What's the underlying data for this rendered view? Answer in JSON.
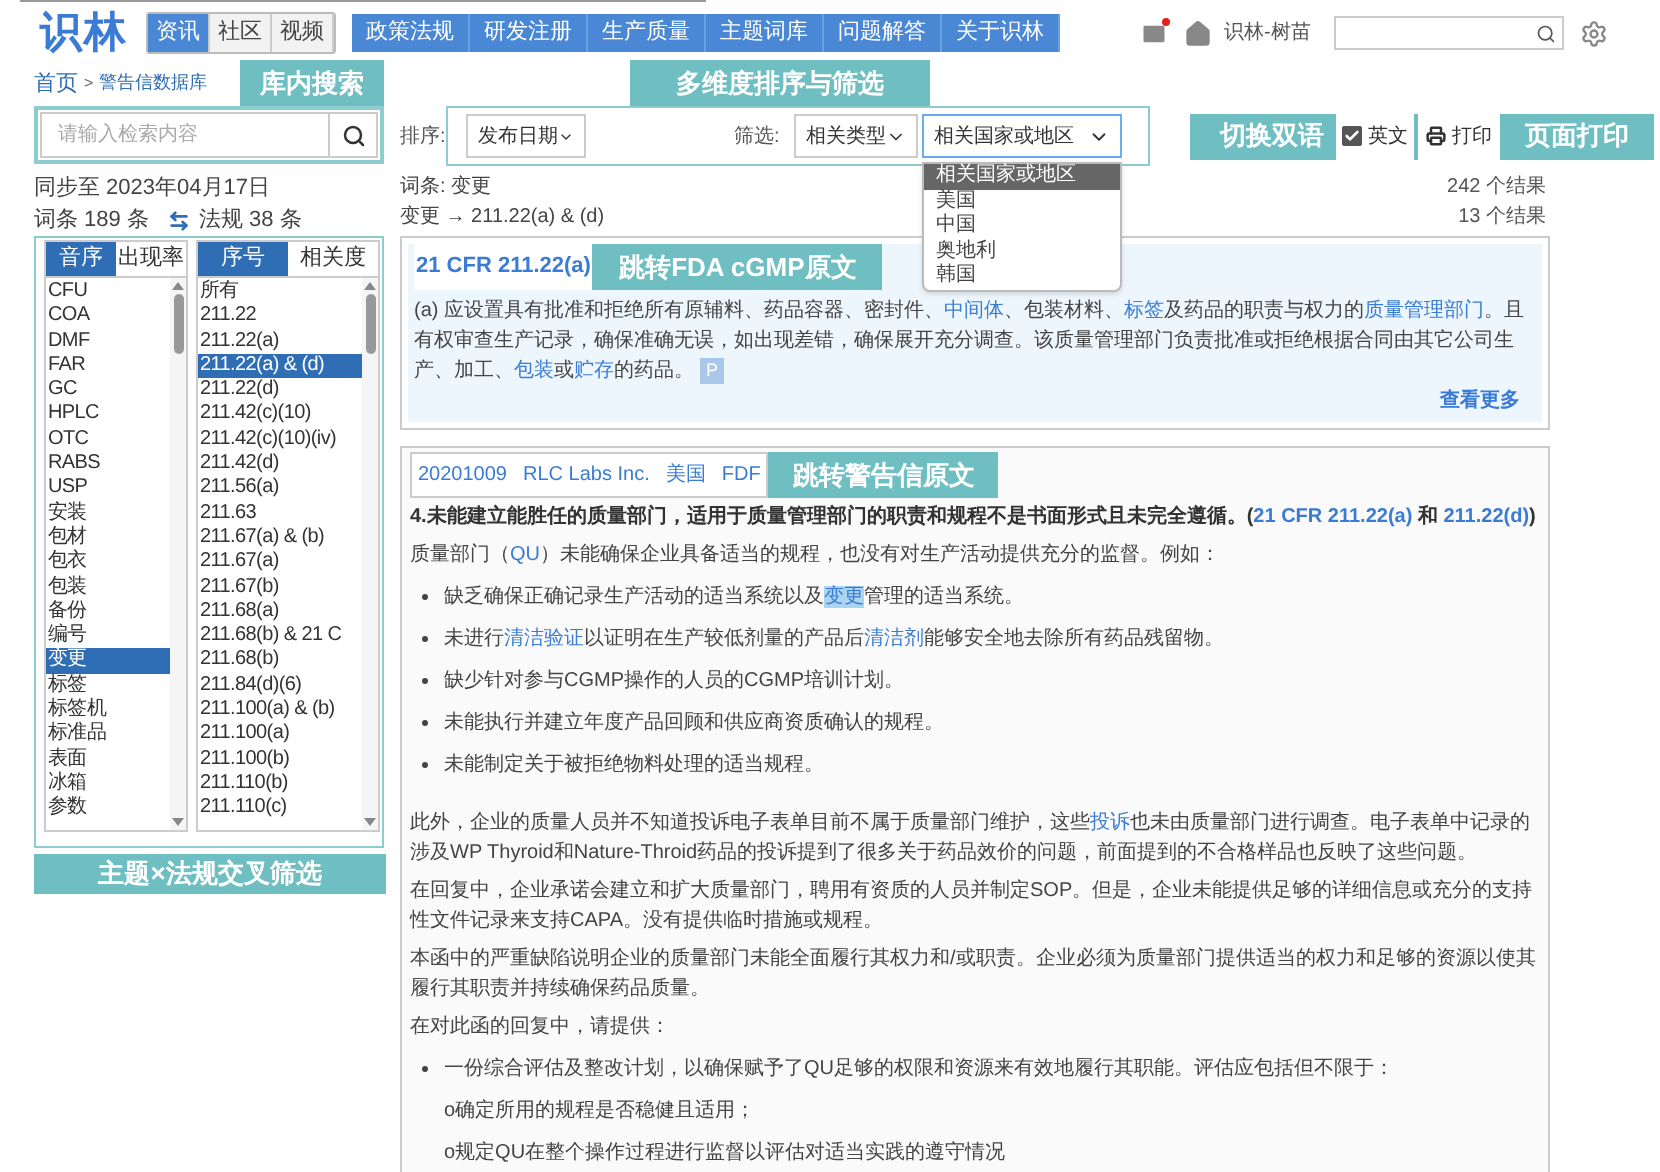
{
  "header": {
    "logo": "识林",
    "tabs": [
      {
        "label": "资讯",
        "selected": true
      },
      {
        "label": "社区",
        "selected": false
      },
      {
        "label": "视频",
        "selected": false
      }
    ],
    "nav": [
      "政策法规",
      "研发注册",
      "生产质量",
      "主题词库",
      "问题解答",
      "关于识林"
    ],
    "mail_unread": true,
    "user": "识林-树苗"
  },
  "breadcrumb": {
    "home": "首页",
    "separator": ">",
    "current": "警告信数据库"
  },
  "search": {
    "placeholder": "请输入检索内容"
  },
  "sync": "同步至 2023年04月17日",
  "counts": {
    "terms": "词条 189 条",
    "regs": "法规 38 条"
  },
  "topic_list": {
    "tabs": [
      {
        "label": "音序",
        "selected": true
      },
      {
        "label": "出现率",
        "selected": false
      }
    ],
    "items": [
      {
        "label": "CFU",
        "selected": false
      },
      {
        "label": "COA",
        "selected": false
      },
      {
        "label": "DMF",
        "selected": false
      },
      {
        "label": "FAR",
        "selected": false
      },
      {
        "label": "GC",
        "selected": false
      },
      {
        "label": "HPLC",
        "selected": false
      },
      {
        "label": "OTC",
        "selected": false
      },
      {
        "label": "RABS",
        "selected": false
      },
      {
        "label": "USP",
        "selected": false
      },
      {
        "label": "安装",
        "selected": false
      },
      {
        "label": "包材",
        "selected": false
      },
      {
        "label": "包衣",
        "selected": false
      },
      {
        "label": "包装",
        "selected": false
      },
      {
        "label": "备份",
        "selected": false
      },
      {
        "label": "编号",
        "selected": false
      },
      {
        "label": "变更",
        "selected": true
      },
      {
        "label": "标签",
        "selected": false
      },
      {
        "label": "标签机",
        "selected": false
      },
      {
        "label": "标准品",
        "selected": false
      },
      {
        "label": "表面",
        "selected": false
      },
      {
        "label": "冰箱",
        "selected": false
      },
      {
        "label": "参数",
        "selected": false
      }
    ]
  },
  "reg_list": {
    "tabs": [
      {
        "label": "序号",
        "selected": true
      },
      {
        "label": "相关度",
        "selected": false
      }
    ],
    "items": [
      {
        "label": "所有",
        "selected": false
      },
      {
        "label": "211.22",
        "selected": false
      },
      {
        "label": "211.22(a)",
        "selected": false
      },
      {
        "label": "211.22(a) & (d)",
        "selected": true
      },
      {
        "label": "211.22(d)",
        "selected": false
      },
      {
        "label": "211.42(c)(10)",
        "selected": false
      },
      {
        "label": "211.42(c)(10)(iv)",
        "selected": false
      },
      {
        "label": "211.42(d)",
        "selected": false
      },
      {
        "label": "211.56(a)",
        "selected": false
      },
      {
        "label": "211.63",
        "selected": false
      },
      {
        "label": "211.67(a) & (b)",
        "selected": false
      },
      {
        "label": "211.67(a)",
        "selected": false
      },
      {
        "label": "211.67(b)",
        "selected": false
      },
      {
        "label": "211.68(a)",
        "selected": false
      },
      {
        "label": "211.68(b) & 21 C",
        "selected": false
      },
      {
        "label": "211.68(b)",
        "selected": false
      },
      {
        "label": "211.84(d)(6)",
        "selected": false
      },
      {
        "label": "211.100(a) & (b)",
        "selected": false
      },
      {
        "label": "211.100(a)",
        "selected": false
      },
      {
        "label": "211.100(b)",
        "selected": false
      },
      {
        "label": "211.110(b)",
        "selected": false
      },
      {
        "label": "211.110(c)",
        "selected": false
      }
    ]
  },
  "toolbar": {
    "sort_label": "排序:",
    "sort_value": "发布日期",
    "filter_label": "筛选:",
    "type_value": "相关类型",
    "region_value": "相关国家或地区",
    "region_options": [
      {
        "label": "相关国家或地区",
        "selected": true
      },
      {
        "label": "美国",
        "selected": false
      },
      {
        "label": "中国",
        "selected": false
      },
      {
        "label": "奥地利",
        "selected": false
      },
      {
        "label": "韩国",
        "selected": false
      }
    ],
    "english": {
      "label": "英文",
      "checked": true
    },
    "print": "打印"
  },
  "summary": {
    "term": "词条: 变更",
    "path": "变更 → 211.22(a) & (d)",
    "total": "242 个结果",
    "sub": "13 个结果"
  },
  "reg_card": {
    "title": "21 CFR 211.22(a)",
    "body": [
      {
        "kind": "text",
        "text": "(a) 应设置具有批准和拒绝所有原辅料、药品容器、密封件、"
      },
      {
        "kind": "link",
        "text": "中间体"
      },
      {
        "kind": "text",
        "text": "、包装材料、"
      },
      {
        "kind": "link",
        "text": "标签"
      },
      {
        "kind": "text",
        "text": "及药品的职责与权力的"
      },
      {
        "kind": "link",
        "text": "质量管理部门"
      },
      {
        "kind": "text",
        "text": "。且有权审查生产记录，确保准确无误，如出现差错，确保展开充分调查。该质量管理部门负责批准或拒绝根据合同由其它公司生产、加工、"
      },
      {
        "kind": "link",
        "text": "包装"
      },
      {
        "kind": "text",
        "text": "或"
      },
      {
        "kind": "link",
        "text": "贮存"
      },
      {
        "kind": "text",
        "text": "的药品。"
      }
    ],
    "badge": "P",
    "more": "查看更多"
  },
  "letter_card": {
    "meta": [
      "20201009",
      "RLC Labs Inc.",
      "美国",
      "FDF"
    ],
    "blocks": [
      {
        "kind": "heading",
        "segs": [
          {
            "kind": "text",
            "text": "4.未能建立能胜任的质量部门，适用于质量管理部门的职责和规程不是书面形式且未完全遵循。("
          },
          {
            "kind": "link",
            "text": "21 CFR 211.22(a)"
          },
          {
            "kind": "text",
            "text": " 和 "
          },
          {
            "kind": "link",
            "text": "211.22(d)"
          },
          {
            "kind": "text",
            "text": ")"
          }
        ]
      },
      {
        "kind": "para",
        "segs": [
          {
            "kind": "text",
            "text": "质量部门（"
          },
          {
            "kind": "link",
            "text": "QU"
          },
          {
            "kind": "text",
            "text": "）未能确保企业具备适当的规程，也没有对生产活动提供充分的监督。例如："
          }
        ]
      },
      {
        "kind": "bullet",
        "segs": [
          {
            "kind": "text",
            "text": "缺乏确保正确记录生产活动的适当系统以及"
          },
          {
            "kind": "mark",
            "text": "变更"
          },
          {
            "kind": "text",
            "text": "管理的适当系统。"
          }
        ]
      },
      {
        "kind": "bullet",
        "segs": [
          {
            "kind": "text",
            "text": "未进行"
          },
          {
            "kind": "link",
            "text": "清洁验证"
          },
          {
            "kind": "text",
            "text": "以证明在生产较低剂量的产品后"
          },
          {
            "kind": "link",
            "text": "清洁剂"
          },
          {
            "kind": "text",
            "text": "能够安全地去除所有药品残留物。"
          }
        ]
      },
      {
        "kind": "bullet",
        "segs": [
          {
            "kind": "text",
            "text": "缺少针对参与CGMP操作的人员的CGMP培训计划。"
          }
        ]
      },
      {
        "kind": "bullet",
        "segs": [
          {
            "kind": "text",
            "text": "未能执行并建立年度产品回顾和供应商资质确认的规程。"
          }
        ]
      },
      {
        "kind": "bullet",
        "segs": [
          {
            "kind": "text",
            "text": "未能制定关于被拒绝物料处理的适当规程。"
          }
        ]
      },
      {
        "kind": "gap_para",
        "segs": [
          {
            "kind": "text",
            "text": "此外，企业的质量人员并不知道投诉电子表单目前不属于质量部门维护，这些"
          },
          {
            "kind": "link",
            "text": "投诉"
          },
          {
            "kind": "text",
            "text": "也未由质量部门进行调查。电子表单中记录的涉及WP Thyroid和Nature-Throid药品的投诉提到了很多关于药品效价的问题，前面提到的不合格样品也反映了这些问题。"
          }
        ]
      },
      {
        "kind": "para",
        "segs": [
          {
            "kind": "text",
            "text": "在回复中，企业承诺会建立和扩大质量部门，聘用有资质的人员并制定SOP。但是，企业未能提供足够的详细信息或充分的支持性文件记录来支持CAPA。没有提供临时措施或规程。"
          }
        ]
      },
      {
        "kind": "para",
        "segs": [
          {
            "kind": "text",
            "text": "本函中的严重缺陷说明企业的质量部门未能全面履行其权力和/或职责。企业必须为质量部门提供适当的权力和足够的资源以使其履行其职责并持续确保药品质量。"
          }
        ]
      },
      {
        "kind": "para",
        "segs": [
          {
            "kind": "text",
            "text": "在对此函的回复中，请提供："
          }
        ]
      },
      {
        "kind": "bullet",
        "segs": [
          {
            "kind": "text",
            "text": "一份综合评估及整改计划，以确保赋予了QU足够的权限和资源来有效地履行其职能。评估应包括但不限于："
          }
        ]
      },
      {
        "kind": "sub",
        "segs": [
          {
            "kind": "text",
            "text": "o确定所用的规程是否稳健且适用；"
          }
        ]
      },
      {
        "kind": "sub",
        "segs": [
          {
            "kind": "text",
            "text": "o规定QU在整个操作过程进行监督以评估对适当实践的遵守情况"
          }
        ]
      }
    ]
  },
  "annotations": {
    "search": "库内搜索",
    "sort": "多维度排序与筛选",
    "bilingual": "切换双语",
    "print": "页面打印",
    "reg": "跳转FDA cGMP原文",
    "letter": "跳转警告信原文",
    "lists": "主题×法规交叉筛选"
  }
}
